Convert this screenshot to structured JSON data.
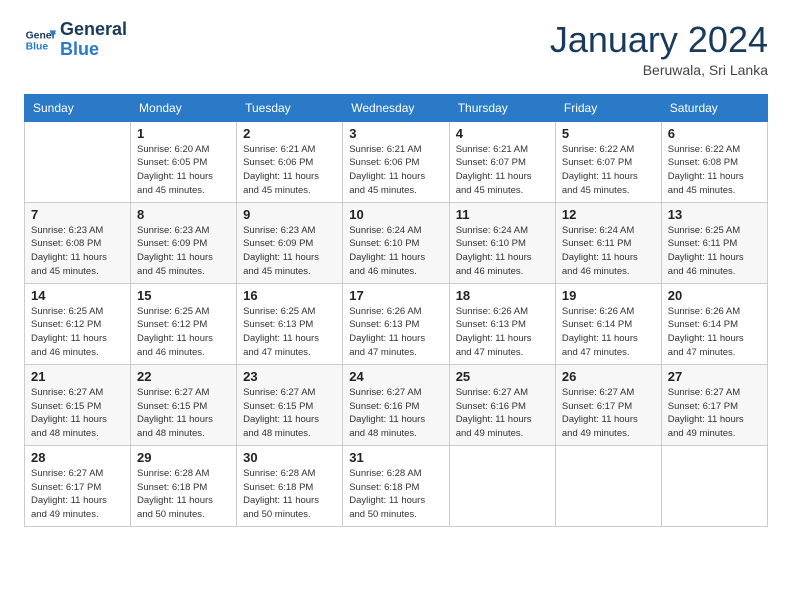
{
  "header": {
    "logo": {
      "line1": "General",
      "line2": "Blue"
    },
    "title": "January 2024",
    "subtitle": "Beruwala, Sri Lanka"
  },
  "days_of_week": [
    "Sunday",
    "Monday",
    "Tuesday",
    "Wednesday",
    "Thursday",
    "Friday",
    "Saturday"
  ],
  "weeks": [
    [
      {
        "num": "",
        "info": ""
      },
      {
        "num": "1",
        "info": "Sunrise: 6:20 AM\nSunset: 6:05 PM\nDaylight: 11 hours\nand 45 minutes."
      },
      {
        "num": "2",
        "info": "Sunrise: 6:21 AM\nSunset: 6:06 PM\nDaylight: 11 hours\nand 45 minutes."
      },
      {
        "num": "3",
        "info": "Sunrise: 6:21 AM\nSunset: 6:06 PM\nDaylight: 11 hours\nand 45 minutes."
      },
      {
        "num": "4",
        "info": "Sunrise: 6:21 AM\nSunset: 6:07 PM\nDaylight: 11 hours\nand 45 minutes."
      },
      {
        "num": "5",
        "info": "Sunrise: 6:22 AM\nSunset: 6:07 PM\nDaylight: 11 hours\nand 45 minutes."
      },
      {
        "num": "6",
        "info": "Sunrise: 6:22 AM\nSunset: 6:08 PM\nDaylight: 11 hours\nand 45 minutes."
      }
    ],
    [
      {
        "num": "7",
        "info": "Sunrise: 6:23 AM\nSunset: 6:08 PM\nDaylight: 11 hours\nand 45 minutes."
      },
      {
        "num": "8",
        "info": "Sunrise: 6:23 AM\nSunset: 6:09 PM\nDaylight: 11 hours\nand 45 minutes."
      },
      {
        "num": "9",
        "info": "Sunrise: 6:23 AM\nSunset: 6:09 PM\nDaylight: 11 hours\nand 45 minutes."
      },
      {
        "num": "10",
        "info": "Sunrise: 6:24 AM\nSunset: 6:10 PM\nDaylight: 11 hours\nand 46 minutes."
      },
      {
        "num": "11",
        "info": "Sunrise: 6:24 AM\nSunset: 6:10 PM\nDaylight: 11 hours\nand 46 minutes."
      },
      {
        "num": "12",
        "info": "Sunrise: 6:24 AM\nSunset: 6:11 PM\nDaylight: 11 hours\nand 46 minutes."
      },
      {
        "num": "13",
        "info": "Sunrise: 6:25 AM\nSunset: 6:11 PM\nDaylight: 11 hours\nand 46 minutes."
      }
    ],
    [
      {
        "num": "14",
        "info": "Sunrise: 6:25 AM\nSunset: 6:12 PM\nDaylight: 11 hours\nand 46 minutes."
      },
      {
        "num": "15",
        "info": "Sunrise: 6:25 AM\nSunset: 6:12 PM\nDaylight: 11 hours\nand 46 minutes."
      },
      {
        "num": "16",
        "info": "Sunrise: 6:25 AM\nSunset: 6:13 PM\nDaylight: 11 hours\nand 47 minutes."
      },
      {
        "num": "17",
        "info": "Sunrise: 6:26 AM\nSunset: 6:13 PM\nDaylight: 11 hours\nand 47 minutes."
      },
      {
        "num": "18",
        "info": "Sunrise: 6:26 AM\nSunset: 6:13 PM\nDaylight: 11 hours\nand 47 minutes."
      },
      {
        "num": "19",
        "info": "Sunrise: 6:26 AM\nSunset: 6:14 PM\nDaylight: 11 hours\nand 47 minutes."
      },
      {
        "num": "20",
        "info": "Sunrise: 6:26 AM\nSunset: 6:14 PM\nDaylight: 11 hours\nand 47 minutes."
      }
    ],
    [
      {
        "num": "21",
        "info": "Sunrise: 6:27 AM\nSunset: 6:15 PM\nDaylight: 11 hours\nand 48 minutes."
      },
      {
        "num": "22",
        "info": "Sunrise: 6:27 AM\nSunset: 6:15 PM\nDaylight: 11 hours\nand 48 minutes."
      },
      {
        "num": "23",
        "info": "Sunrise: 6:27 AM\nSunset: 6:15 PM\nDaylight: 11 hours\nand 48 minutes."
      },
      {
        "num": "24",
        "info": "Sunrise: 6:27 AM\nSunset: 6:16 PM\nDaylight: 11 hours\nand 48 minutes."
      },
      {
        "num": "25",
        "info": "Sunrise: 6:27 AM\nSunset: 6:16 PM\nDaylight: 11 hours\nand 49 minutes."
      },
      {
        "num": "26",
        "info": "Sunrise: 6:27 AM\nSunset: 6:17 PM\nDaylight: 11 hours\nand 49 minutes."
      },
      {
        "num": "27",
        "info": "Sunrise: 6:27 AM\nSunset: 6:17 PM\nDaylight: 11 hours\nand 49 minutes."
      }
    ],
    [
      {
        "num": "28",
        "info": "Sunrise: 6:27 AM\nSunset: 6:17 PM\nDaylight: 11 hours\nand 49 minutes."
      },
      {
        "num": "29",
        "info": "Sunrise: 6:28 AM\nSunset: 6:18 PM\nDaylight: 11 hours\nand 50 minutes."
      },
      {
        "num": "30",
        "info": "Sunrise: 6:28 AM\nSunset: 6:18 PM\nDaylight: 11 hours\nand 50 minutes."
      },
      {
        "num": "31",
        "info": "Sunrise: 6:28 AM\nSunset: 6:18 PM\nDaylight: 11 hours\nand 50 minutes."
      },
      {
        "num": "",
        "info": ""
      },
      {
        "num": "",
        "info": ""
      },
      {
        "num": "",
        "info": ""
      }
    ]
  ]
}
